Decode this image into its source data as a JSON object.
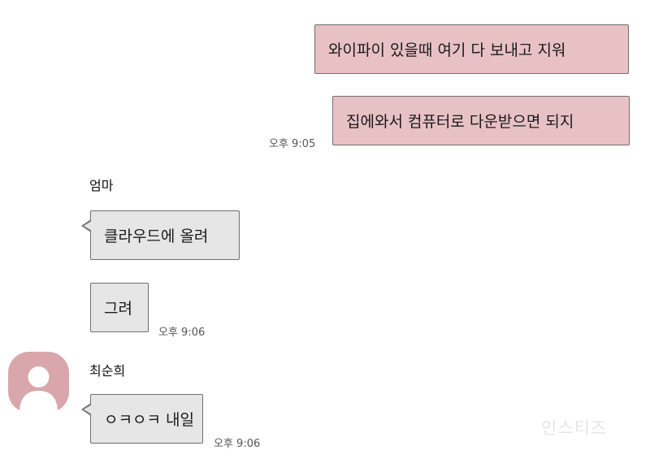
{
  "messages": [
    {
      "text": "와이파이 있을때 여기 다 보내고 지워",
      "side": "out"
    },
    {
      "text": "집에와서 컴퓨터로 다운받으면 되지",
      "side": "out",
      "time": "오후 9:05"
    },
    {
      "sender": "엄마",
      "text": "클라우드에 올려",
      "side": "in"
    },
    {
      "text": "그려",
      "side": "in",
      "time": "오후 9:06"
    },
    {
      "sender": "최순희",
      "text": "ㅇㅋㅇㅋ 내일",
      "side": "in",
      "time": "오후 9:06"
    }
  ],
  "colors": {
    "outgoing_bubble": "#e8c1c5",
    "incoming_bubble": "#e6e6e6",
    "avatar": "#d8a6ab"
  },
  "icons": {
    "avatar": "person-silhouette-icon"
  },
  "watermark": "인스티즈"
}
